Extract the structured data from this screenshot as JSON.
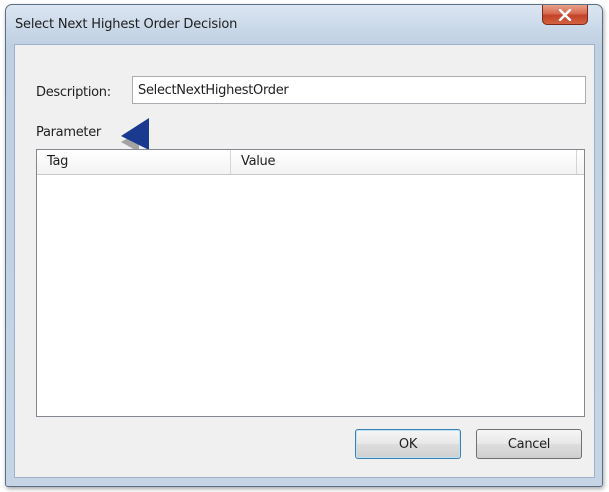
{
  "window": {
    "title": "Select Next Highest Order Decision",
    "close_label": "×"
  },
  "form": {
    "description_label": "Description:",
    "description_value": "SelectNextHighestOrder",
    "parameter_label": "Parameter"
  },
  "parameter_list": {
    "columns": [
      "Tag",
      "Value"
    ],
    "rows": []
  },
  "buttons": {
    "ok_label": "OK",
    "cancel_label": "Cancel"
  },
  "colors": {
    "pointer_arrow": "#1a3a8f",
    "close_button": "#c34229"
  },
  "icons": {
    "close": "close-icon",
    "pointer": "pointer-arrow-icon"
  }
}
